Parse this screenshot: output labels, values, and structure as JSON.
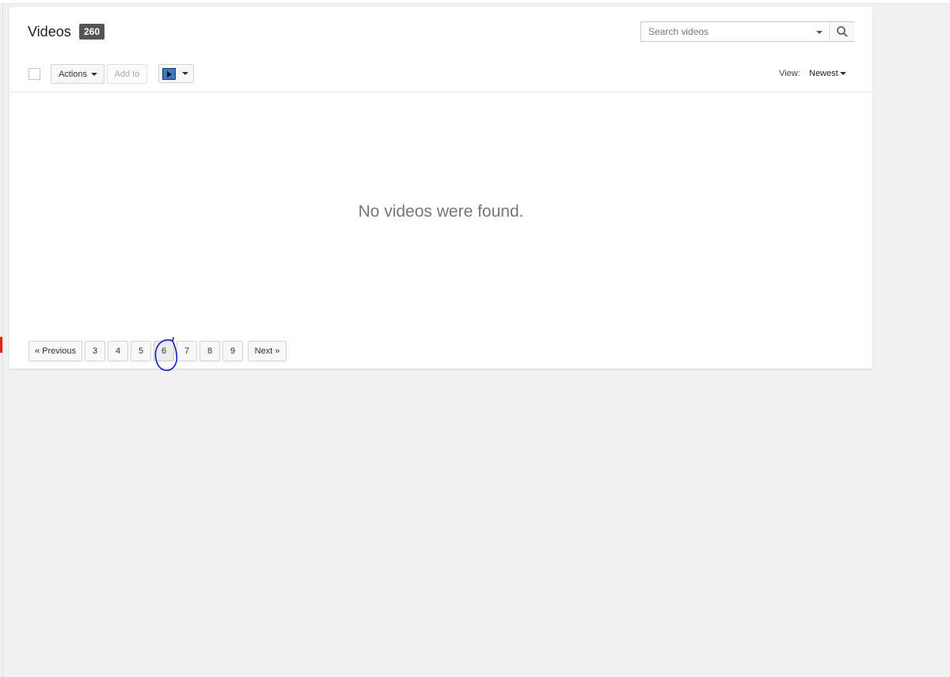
{
  "header": {
    "title": "Videos",
    "count": "260"
  },
  "search": {
    "placeholder": "Search videos"
  },
  "toolbar": {
    "actions_label": "Actions",
    "add_to_label": "Add to",
    "view_label": "View:",
    "view_value": "Newest"
  },
  "main": {
    "empty_message": "No videos were found."
  },
  "pagination": {
    "previous_label": "« Previous",
    "next_label": "Next »",
    "pages": [
      "3",
      "4",
      "5",
      "6",
      "7",
      "8",
      "9"
    ],
    "current_page": "6"
  },
  "colors": {
    "accent_red": "#e62117",
    "annotation_blue": "#1020c8",
    "badge_bg": "#555555"
  },
  "icons": {
    "search": "search-icon",
    "dropdown": "caret-down-icon",
    "thumbnail": "video-thumbnail-icon"
  }
}
